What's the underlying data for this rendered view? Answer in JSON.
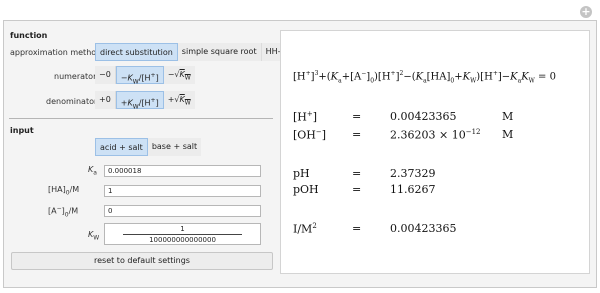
{
  "window": {
    "plus_icon": "+"
  },
  "function_section": {
    "title": "function",
    "approx_label": "approximation method",
    "approx_options": [
      "direct substitution",
      "simple square root",
      "HH–like"
    ],
    "approx_selected": "direct substitution",
    "numerator_label": "numerator",
    "numerator_options": [
      "−0",
      "−K_W/[H⁺]",
      "−√K_W"
    ],
    "numerator_selected": "−K_W/[H⁺]",
    "denominator_label": "denominator",
    "denominator_options": [
      "+0",
      "+K_W/[H⁺]",
      "+√K_W"
    ],
    "denominator_selected": "+K_W/[H⁺]"
  },
  "input_section": {
    "title": "input",
    "mode_options": [
      "acid + salt",
      "base + salt"
    ],
    "mode_selected": "acid + salt",
    "ka_value": "0.000018",
    "ha_value": "1",
    "a_value": "0",
    "kw_numerator": "1",
    "kw_denominator": "100000000000000",
    "reset_label": "reset to default settings"
  },
  "results": {
    "equals": "=",
    "h_value": "0.00423365",
    "h_unit": "M",
    "oh_mantissa": "2.36203 × 10",
    "oh_exponent": "−12",
    "oh_unit": "M",
    "pH_label": "pH",
    "pH_value": "2.37329",
    "pOH_label": "pOH",
    "pOH_value": "11.6267",
    "ionic_label": "I/M",
    "ionic_exp": "2",
    "ionic_value": "0.00423365"
  },
  "colors": {
    "selected_bg": "#cde1f5",
    "selected_border": "#9cc0e6",
    "panel_bg": "#f4f4f4"
  },
  "icons": [
    "plus-icon",
    "square-root-icon"
  ]
}
